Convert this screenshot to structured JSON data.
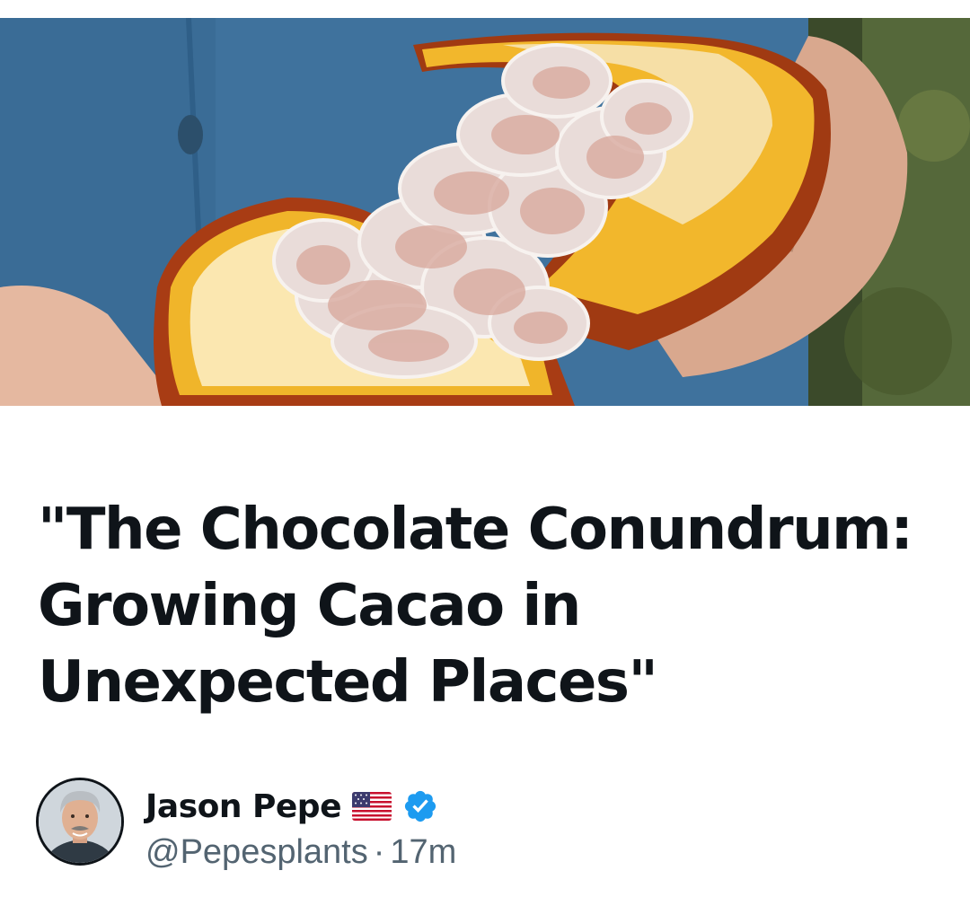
{
  "article": {
    "title": "\"The Chocolate Conundrum: Growing Cacao in Unexpected Places\""
  },
  "author": {
    "name": "Jason Pepe",
    "handle": "@Pepesplants",
    "separator": "·",
    "time": "17m",
    "flag_icon": "us-flag-icon",
    "verified_icon": "verified-badge-icon",
    "verified_color": "#1d9bf0"
  },
  "colors": {
    "text_primary": "#0f1419",
    "text_secondary": "#536471",
    "background": "#ffffff"
  }
}
